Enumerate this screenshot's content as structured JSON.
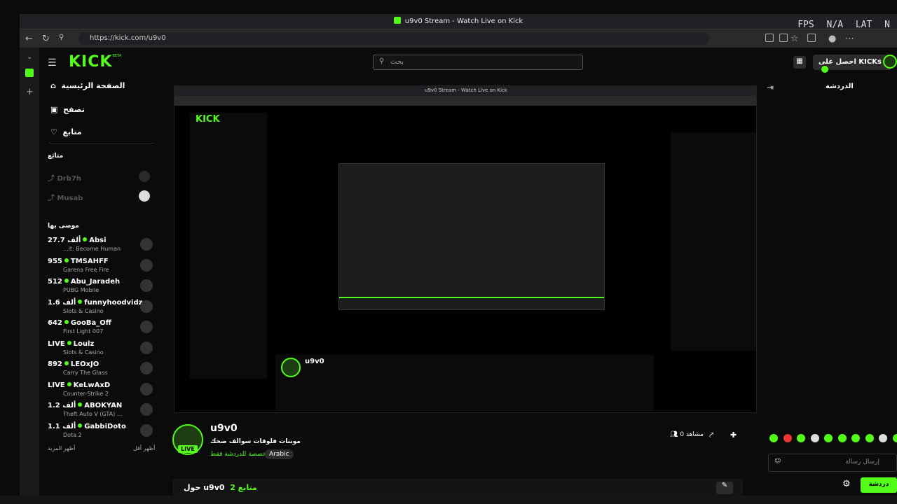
{
  "browser": {
    "tab_title": "u9v0 Stream - Watch Live on Kick",
    "url": "https://kick.com/u9v0",
    "hud": [
      "FPS",
      "N/A",
      "LAT",
      "N"
    ]
  },
  "kick_header": {
    "logo": "KICK",
    "logo_beta": "BETA",
    "search_placeholder": "بحث",
    "kicks_button": "احصل على KICKs"
  },
  "sidebar": {
    "nav": [
      {
        "label": "الصفحة الرئيسية",
        "icon": "home-icon"
      },
      {
        "label": "تصفح",
        "icon": "browse-icon"
      },
      {
        "label": "متابع",
        "icon": "heart-icon"
      }
    ],
    "following_header": "متابَع",
    "following": [
      {
        "name": "Drb7h"
      },
      {
        "name": "Musab"
      }
    ],
    "recommended_header": "موصى بها",
    "recommended": [
      {
        "name": "Absi",
        "viewers": "27.7 ألف",
        "category": "...it: Become Human"
      },
      {
        "name": "TMSAHFF",
        "viewers": "955",
        "category": "Garena Free Fire"
      },
      {
        "name": "Abu_Jaradeh",
        "viewers": "512",
        "category": "PUBG Mobile"
      },
      {
        "name": "funnyhoodvidz",
        "viewers": "1.6 ألف",
        "category": "Slots & Casino"
      },
      {
        "name": "GooBa_Off",
        "viewers": "642",
        "category": "First Light 007"
      },
      {
        "name": "Loulz",
        "viewers": "LIVE",
        "category": "Slots & Casino"
      },
      {
        "name": "LEOxJO",
        "viewers": "892",
        "category": "Carry The Glass"
      },
      {
        "name": "KeLwAxD",
        "viewers": "LIVE",
        "category": "Counter-Strike 2"
      },
      {
        "name": "ABOKYAN",
        "viewers": "1.2 ألف",
        "category": "Theft Auto V (GTA) ..."
      },
      {
        "name": "GabbiDoto",
        "viewers": "1.1 ألف",
        "category": "Dota 2"
      }
    ],
    "show_more": "أظهر المزيد",
    "show_less": "أظهر أقل"
  },
  "chat": {
    "title": "الدردشة",
    "input_placeholder": "إرسال رسالة",
    "send_label": "دردشة"
  },
  "channel": {
    "name": "u9v0",
    "live": "LIVE",
    "title": "مونتات فلوقات سوالف ضحك",
    "tag_chat": "مخصصة للدردشة فقط",
    "tag_lang": "Arabic",
    "viewers": "0 مشاهد",
    "about": "حول u9v0",
    "followers": "2 متابع"
  },
  "nested": {
    "nested_title": "u9v0 Stream - Watch Live on Kick"
  }
}
